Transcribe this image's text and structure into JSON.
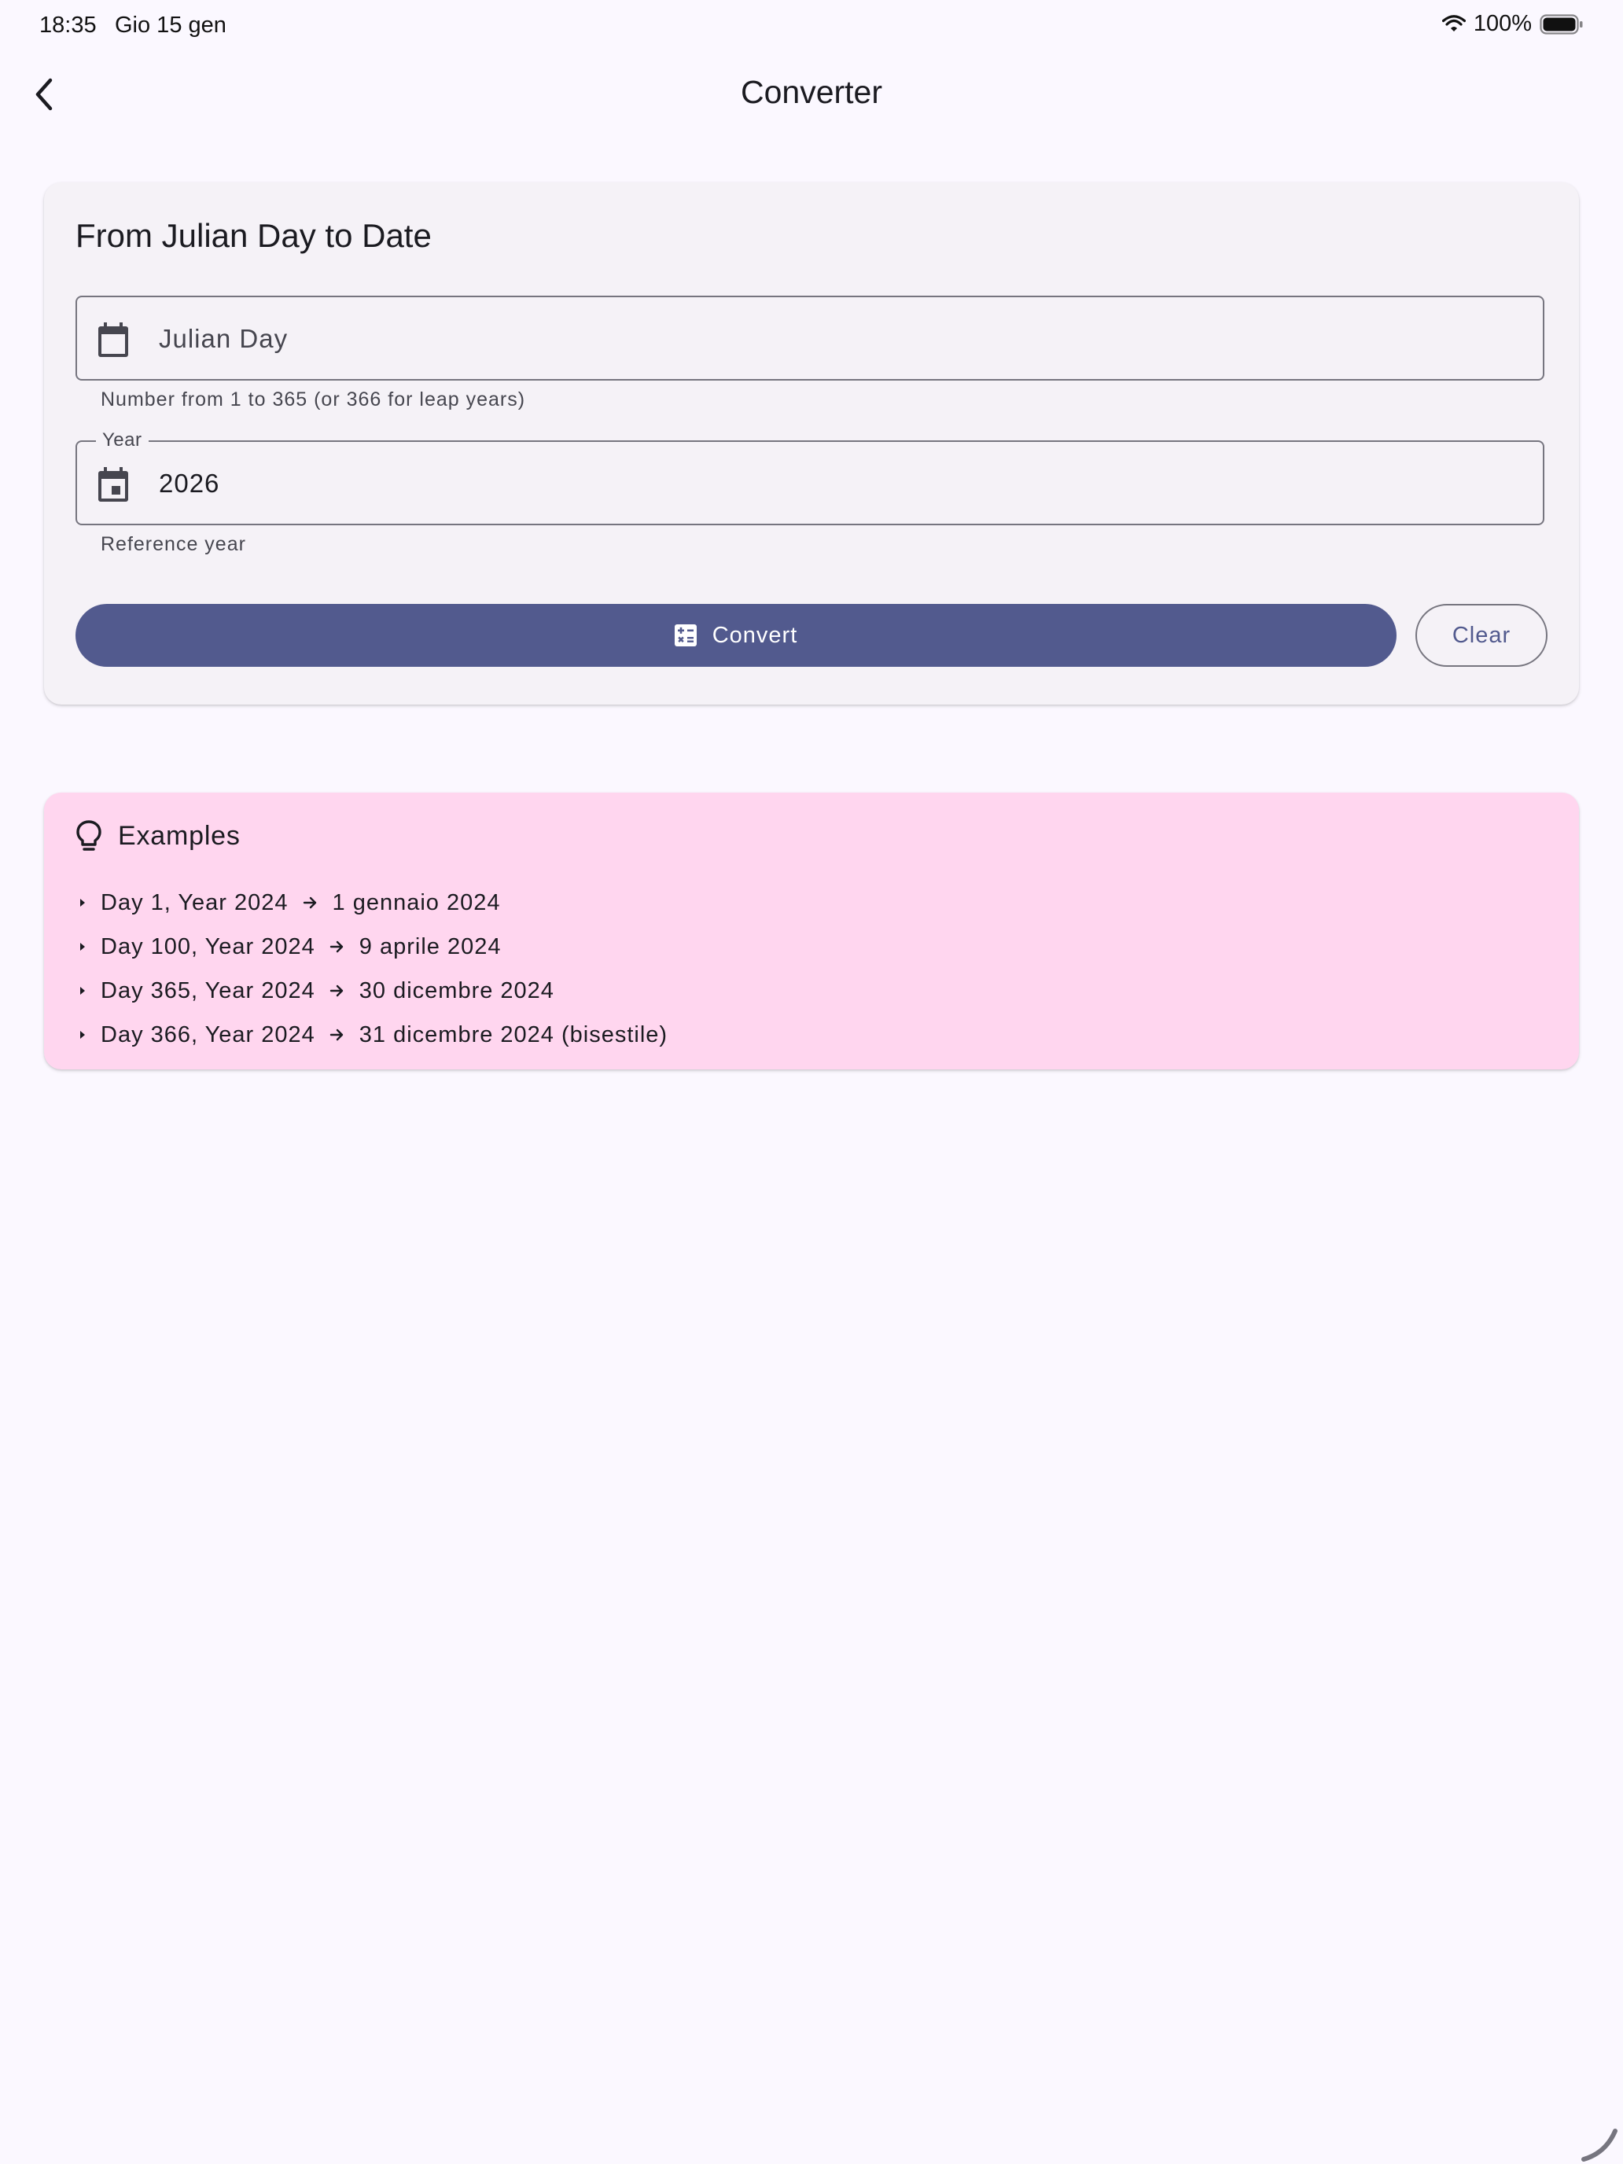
{
  "status_bar": {
    "time": "18:35",
    "date": "Gio 15 gen",
    "battery": "100%"
  },
  "app_bar": {
    "title": "Converter",
    "back_icon": "chevron-left-icon"
  },
  "converter": {
    "title": "From Julian Day to Date",
    "julian_field": {
      "placeholder": "Julian Day",
      "value": "",
      "helper": "Number from 1 to 365 (or 366 for leap years)",
      "icon": "calendar-icon"
    },
    "year_field": {
      "label": "Year",
      "value": "2026",
      "helper": "Reference year",
      "icon": "calendar-today-icon"
    },
    "convert_label": "Convert",
    "convert_icon": "calculate-icon",
    "clear_label": "Clear"
  },
  "examples": {
    "title": "Examples",
    "icon": "lightbulb-icon",
    "items": [
      {
        "input": "Day 1, Year 2024",
        "output": "1 gennaio 2024"
      },
      {
        "input": "Day 100, Year 2024",
        "output": "9 aprile 2024"
      },
      {
        "input": "Day 365, Year 2024",
        "output": "30 dicembre 2024"
      },
      {
        "input": "Day 366, Year 2024",
        "output": "31 dicembre 2024 (bisestile)"
      }
    ]
  },
  "colors": {
    "background": "#fbf8ff",
    "primary": "#525a8e",
    "card_surface": "#f5f2f7",
    "examples_surface": "#ffd6ef"
  }
}
